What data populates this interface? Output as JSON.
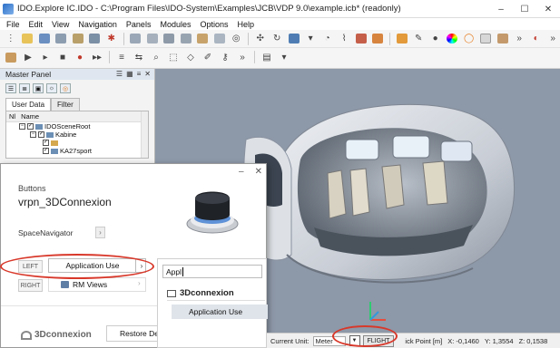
{
  "window": {
    "title": "IDO.Explore IC.IDO - C:\\Program Files\\IDO-System\\Examples\\JCB\\VDP 9.0\\example.icb* (readonly)",
    "minimize": "–",
    "maximize": "☐",
    "close": "✕"
  },
  "menu": [
    "File",
    "Edit",
    "View",
    "Navigation",
    "Panels",
    "Modules",
    "Options",
    "Help"
  ],
  "master_panel": {
    "title": "Master Panel",
    "tabs": [
      "User Data",
      "Filter"
    ],
    "tree_header": [
      "Nl",
      "Name"
    ],
    "tree": [
      {
        "label": "IDOSceneRoot"
      },
      {
        "label": "Kabine"
      },
      {
        "label": ""
      },
      {
        "label": "KA27sport"
      }
    ]
  },
  "dialog": {
    "header": "Buttons",
    "device": "vrpn_3DConnexion",
    "spacenavigator": "SpaceNavigator",
    "left_label": "LEFT",
    "left_value": "Application Use",
    "right_label": "RIGHT",
    "right_value": "RM Views",
    "logo": "3Dconnexion",
    "restore": "Restore Def",
    "close": "✕",
    "minimize": "–"
  },
  "dropdown": {
    "search": "Appl",
    "category": "3Dconnexion",
    "item": "Application Use"
  },
  "status": {
    "unit_label": "Current Unit:",
    "unit_value": "Meter",
    "mode": "FLIGHT",
    "pick_point": "ick Point [m]",
    "x": "X: -0,1460",
    "y": "Y: 1,3554",
    "z": "Z: 0,1538"
  },
  "colors": {
    "viewport_bg": "#8d98a8",
    "annotation": "#d8382a",
    "panel_title_bg": "#dfe6ef"
  }
}
